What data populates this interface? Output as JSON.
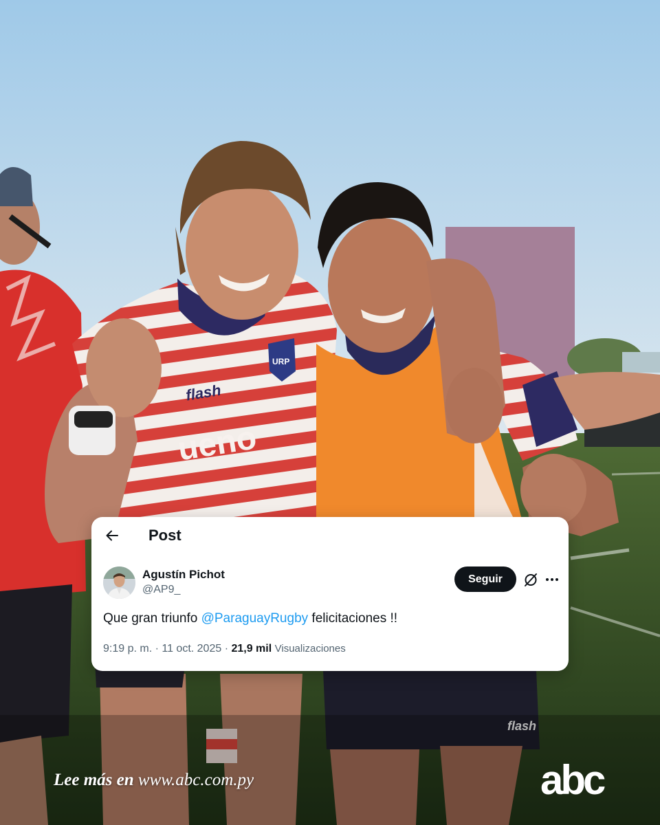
{
  "post": {
    "header_title": "Post",
    "author": {
      "name": "Agustín Pichot",
      "handle": "@AP9_"
    },
    "follow_label": "Seguir",
    "text": {
      "before": "Que gran triunfo ",
      "mention": "@ParaguayRugby",
      "after": " felicitaciones !!"
    },
    "meta": {
      "time_date": "9:19 p. m. · 11 oct. 2025 · ",
      "views_count": "21,9 mil",
      "views_label": "Visualizaciones"
    }
  },
  "footer": {
    "cta_prefix": "Lee más en",
    "cta_url": "www.abc.com.py",
    "logo_text": "abc"
  },
  "photo": {
    "jersey_sponsor": "ueno",
    "jersey_brand": "flash",
    "jersey_crest": "URP"
  },
  "icons": [
    "arrow-left-icon",
    "grok-icon",
    "more-horizontal-icon"
  ],
  "colors": {
    "sky_top": "#a9cfe9",
    "sky_bottom": "#dbe9f3",
    "field_green": "#2f4a22",
    "jersey_red": "#d63a35",
    "bib_orange": "#f0892c",
    "follow_button": "#0f1419",
    "link_blue": "#1d9bf0",
    "secondary_text": "#536471"
  }
}
